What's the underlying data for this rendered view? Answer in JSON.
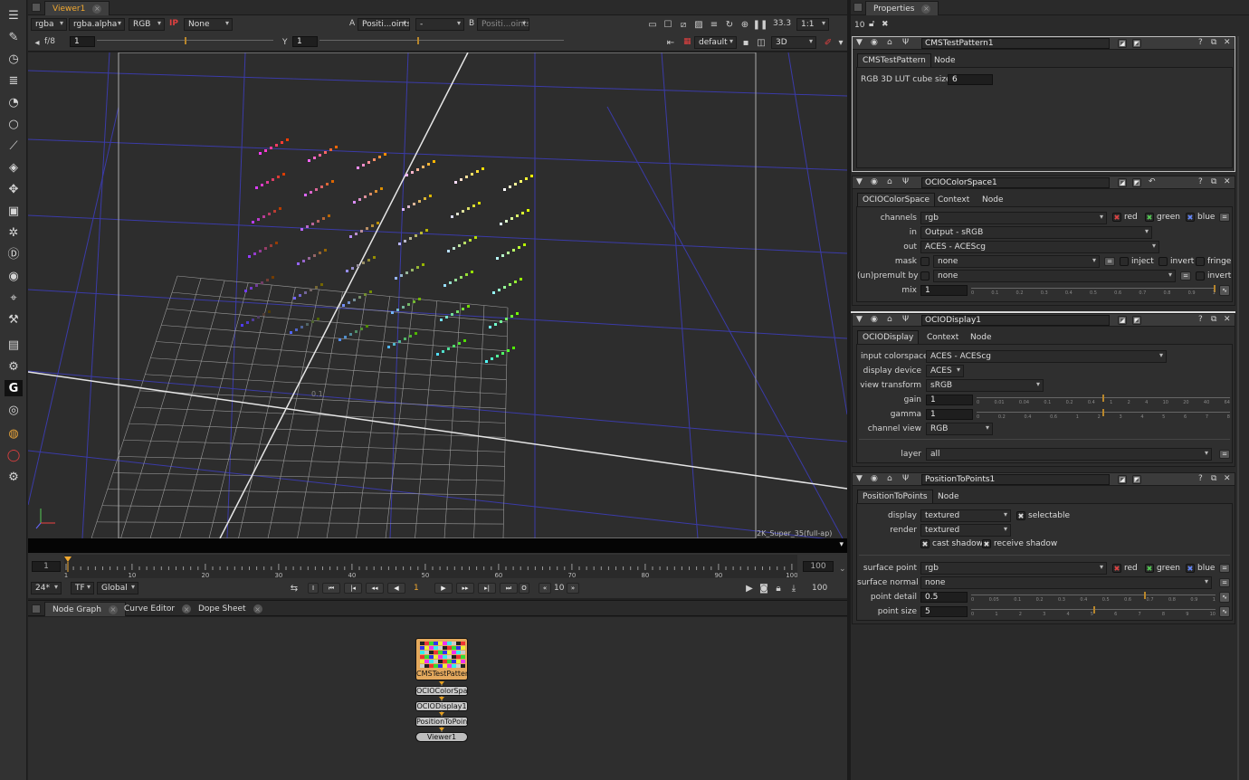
{
  "viewer": {
    "tab": "Viewer1",
    "channels_layer": "rgba",
    "alpha_channel": "rgba.alpha",
    "display_channels": "RGB",
    "ip_label": "IP",
    "ip_value": "None",
    "input_a_label": "A",
    "input_a": "Positi...oints1",
    "wipe": "-",
    "input_b_label": "B",
    "input_b": "Positi...oints1",
    "zoom": "33.3",
    "ratio": "1:1",
    "fstop": "f/8",
    "gain": "1",
    "gamma_label": "Y",
    "gamma": "1",
    "lut": "default",
    "view_mode": "3D",
    "format_label": "2K_Super_35(full-ap)",
    "axis_label": "0.1"
  },
  "timeline": {
    "start": "1",
    "end": "100",
    "ticks": [
      "1",
      "10",
      "20",
      "30",
      "40",
      "50",
      "60",
      "70",
      "80",
      "90",
      "100"
    ],
    "fps": "24*",
    "tf": "TF",
    "global": "Global",
    "in_label": "I",
    "out_label": "O",
    "current_frame": "1",
    "increment": "10",
    "end_frame": "100"
  },
  "bottom_tabs": [
    {
      "label": "Node Graph"
    },
    {
      "label": "Curve Editor"
    },
    {
      "label": "Dope Sheet"
    }
  ],
  "nodes": [
    {
      "label": "CMSTestPattern1"
    },
    {
      "label": "OCIOColorSpace1"
    },
    {
      "label": "OCIODisplay1"
    },
    {
      "label": "PositionToPoints1"
    },
    {
      "label": "Viewer1"
    }
  ],
  "properties": {
    "tab": "Properties",
    "max_panels": "10",
    "cms": {
      "name": "CMSTestPattern1",
      "tabs": [
        "CMSTestPattern",
        "Node"
      ],
      "lut_label": "RGB 3D LUT cube size",
      "lut_value": "6"
    },
    "ocio_cs": {
      "name": "OCIOColorSpace1",
      "tabs": [
        "OCIOColorSpace",
        "Context",
        "Node"
      ],
      "channels_label": "channels",
      "channels": "rgb",
      "red": "red",
      "green": "green",
      "blue": "blue",
      "in_label": "in",
      "in_value": "Output - sRGB",
      "out_label": "out",
      "out_value": "ACES - ACEScg",
      "mask_label": "mask",
      "mask_value": "none",
      "inject": "inject",
      "invert": "invert",
      "fringe": "fringe",
      "unpremult_label": "(un)premult by",
      "unpremult_value": "none",
      "invert2": "invert",
      "mix_label": "mix",
      "mix_value": "1",
      "mix_ticks": [
        "0",
        "0.1",
        "0.2",
        "0.3",
        "0.4",
        "0.5",
        "0.6",
        "0.7",
        "0.8",
        "0.9",
        "1"
      ]
    },
    "ocio_disp": {
      "name": "OCIODisplay1",
      "tabs": [
        "OCIODisplay",
        "Context",
        "Node"
      ],
      "input_label": "input colorspace",
      "input_value": "ACES - ACEScg",
      "device_label": "display device",
      "device_value": "ACES",
      "view_label": "view transform",
      "view_value": "sRGB",
      "gain_label": "gain",
      "gain_value": "1",
      "gain_ticks": [
        "0",
        "0.01",
        "0.04",
        "0.1",
        "0.2",
        "0.4",
        "1",
        "2",
        "4",
        "10",
        "20",
        "40",
        "64"
      ],
      "gamma_label": "gamma",
      "gamma_value": "1",
      "gamma_ticks": [
        "0",
        "0.2",
        "0.4",
        "0.6",
        "1",
        "2",
        "3",
        "4",
        "5",
        "6",
        "7",
        "8"
      ],
      "chview_label": "channel view",
      "chview_value": "RGB",
      "layer_label": "layer",
      "layer_value": "all"
    },
    "p2p": {
      "name": "PositionToPoints1",
      "tabs": [
        "PositionToPoints",
        "Node"
      ],
      "display_label": "display",
      "display_value": "textured",
      "selectable": "selectable",
      "render_label": "render",
      "render_value": "textured",
      "cast_shadow": "cast shadow",
      "receive_shadow": "receive shadow",
      "surface_point_label": "surface point",
      "surface_point_value": "rgb",
      "red": "red",
      "green": "green",
      "blue": "blue",
      "surface_normal_label": "surface normal",
      "surface_normal_value": "none",
      "detail_label": "point detail",
      "detail_value": "0.5",
      "detail_ticks": [
        "0",
        "0.05",
        "0.1",
        "0.2",
        "0.3",
        "0.4",
        "0.5",
        "0.6",
        "0.7",
        "0.8",
        "0.9",
        "1"
      ],
      "size_label": "point size",
      "size_value": "5",
      "size_ticks": [
        "0",
        "1",
        "2",
        "3",
        "4",
        "5",
        "6",
        "7",
        "8",
        "9",
        "10"
      ]
    }
  },
  "colors": {
    "accent_orange": "#f0a830",
    "red_check": "#e04444",
    "green_check": "#55cc55",
    "blue_check": "#6688ff"
  }
}
